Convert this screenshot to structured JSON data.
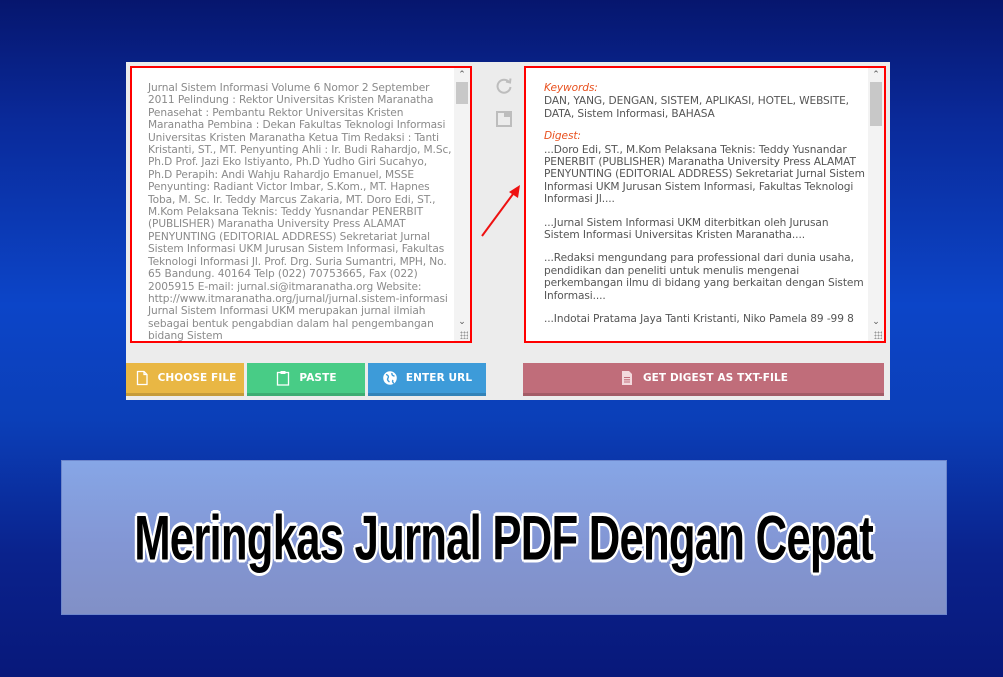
{
  "input_panel": {
    "text": "Jurnal Sistem Informasi Volume 6 Nomor 2 September 2011 Pelindung : Rektor Universitas Kristen Maranatha Penasehat : Pembantu Rektor Universitas Kristen Maranatha Pembina : Dekan Fakultas Teknologi Informasi Universitas Kristen Maranatha Ketua Tim Redaksi : Tanti Kristanti, ST., MT. Penyunting Ahli : Ir. Budi Rahardjo, M.Sc, Ph.D Prof. Jazi Eko Istiyanto, Ph.D Yudho Giri Sucahyo, Ph.D Perapih: Andi Wahju Rahardjo Emanuel, MSSE Penyunting: Radiant Victor Imbar, S.Kom., MT. Hapnes Toba, M. Sc. Ir. Teddy Marcus Zakaria, MT. Doro Edi, ST., M.Kom Pelaksana Teknis: Teddy Yusnandar PENERBIT (PUBLISHER) Maranatha University Press ALAMAT PENYUNTING (EDITORIAL ADDRESS) Sekretariat Jurnal Sistem Informasi UKM Jurusan Sistem Informasi, Fakultas Teknologi Informasi Jl. Prof. Drg. Suria Sumantri, MPH, No. 65 Bandung. 40164 Telp (022) 70753665, Fax (022) 2005915 E-mail: jurnal.si@itmaranatha.org Website: http://www.itmaranatha.org/jurnal/jurnal.sistem-informasi Jurnal Sistem Informasi UKM merupakan jurnal ilmiah sebagai bentuk pengabdian dalam hal pengembangan bidang Sistem"
  },
  "side_tools": {
    "refresh_icon": "refresh-icon",
    "window_icon": "window-icon"
  },
  "output_panel": {
    "keywords_label": "Keywords:",
    "keywords": "DAN, YANG, DENGAN, SISTEM, APLIKASI, HOTEL, WEBSITE, DATA, Sistem Informasi, BAHASA",
    "digest_label": "Digest:",
    "digest_items": [
      "...Doro Edi, ST., M.Kom Pelaksana Teknis: Teddy Yusnandar PENERBIT (PUBLISHER) Maranatha University Press ALAMAT PENYUNTING (EDITORIAL ADDRESS) Sekretariat Jurnal Sistem Informasi UKM Jurusan Sistem Informasi, Fakultas Teknologi Informasi Jl....",
      "...Jurnal Sistem Informasi UKM diterbitkan oleh Jurusan Sistem Informasi Universitas Kristen Maranatha....",
      "...Redaksi mengundang para professional dari dunia usaha, pendidikan dan peneliti untuk menulis mengenai perkembangan ilmu di bidang yang berkaitan dengan Sistem Informasi....",
      "...Indotai Pratama Jaya Tanti Kristanti, Niko Pamela 89 -99 8"
    ]
  },
  "buttons": {
    "choose_file": "CHOOSE FILE",
    "paste": "PASTE",
    "enter_url": "ENTER URL",
    "get_digest": "GET DIGEST AS TXT-FILE"
  },
  "colors": {
    "choose_file": "#e9b744",
    "paste": "#48cc86",
    "enter_url": "#3d9bd9",
    "get_digest": "#c06d7a",
    "highlight": "#ff0000",
    "label_accent": "#e8501e"
  },
  "banner": {
    "title": "Meringkas Jurnal PDF Dengan Cepat"
  }
}
